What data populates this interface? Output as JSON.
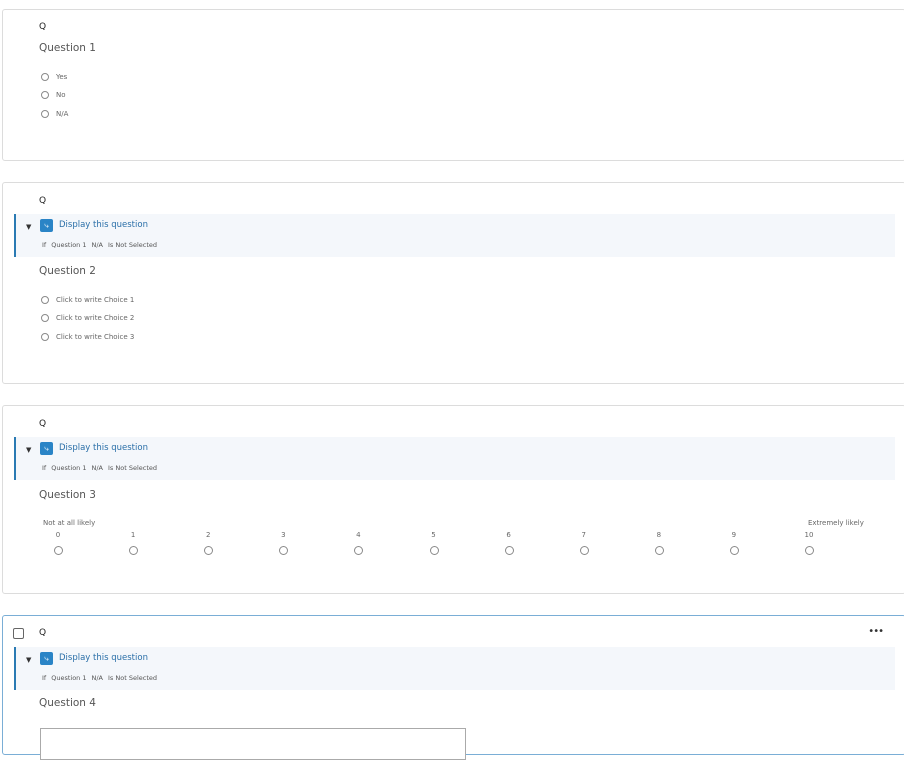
{
  "questions": [
    {
      "label": "Q",
      "title": "Question 1",
      "choices": [
        "Yes",
        "No",
        "N/A"
      ]
    },
    {
      "label": "Q",
      "title": "Question 2",
      "logic": {
        "title": "Display this question",
        "cond_if": "If",
        "cond_question": "Question 1",
        "cond_choice": "N/A",
        "cond_op": "Is Not Selected"
      },
      "choices": [
        "Click to write Choice 1",
        "Click to write Choice 2",
        "Click to write Choice 3"
      ]
    },
    {
      "label": "Q",
      "title": "Question 3",
      "logic": {
        "title": "Display this question",
        "cond_if": "If",
        "cond_question": "Question 1",
        "cond_choice": "N/A",
        "cond_op": "Is Not Selected"
      },
      "scale": {
        "low_label": "Not at all likely",
        "high_label": "Extremely likely",
        "points": [
          "0",
          "1",
          "2",
          "3",
          "4",
          "5",
          "6",
          "7",
          "8",
          "9",
          "10"
        ]
      }
    },
    {
      "label": "Q",
      "title": "Question 4",
      "more_icon": "•••",
      "logic": {
        "title": "Display this question",
        "cond_if": "If",
        "cond_question": "Question 1",
        "cond_choice": "N/A",
        "cond_op": "Is Not Selected"
      }
    }
  ],
  "colors": {
    "accent": "#2a84c6",
    "logic_bg": "#f4f7fb",
    "active_border": "#7aaed6"
  }
}
